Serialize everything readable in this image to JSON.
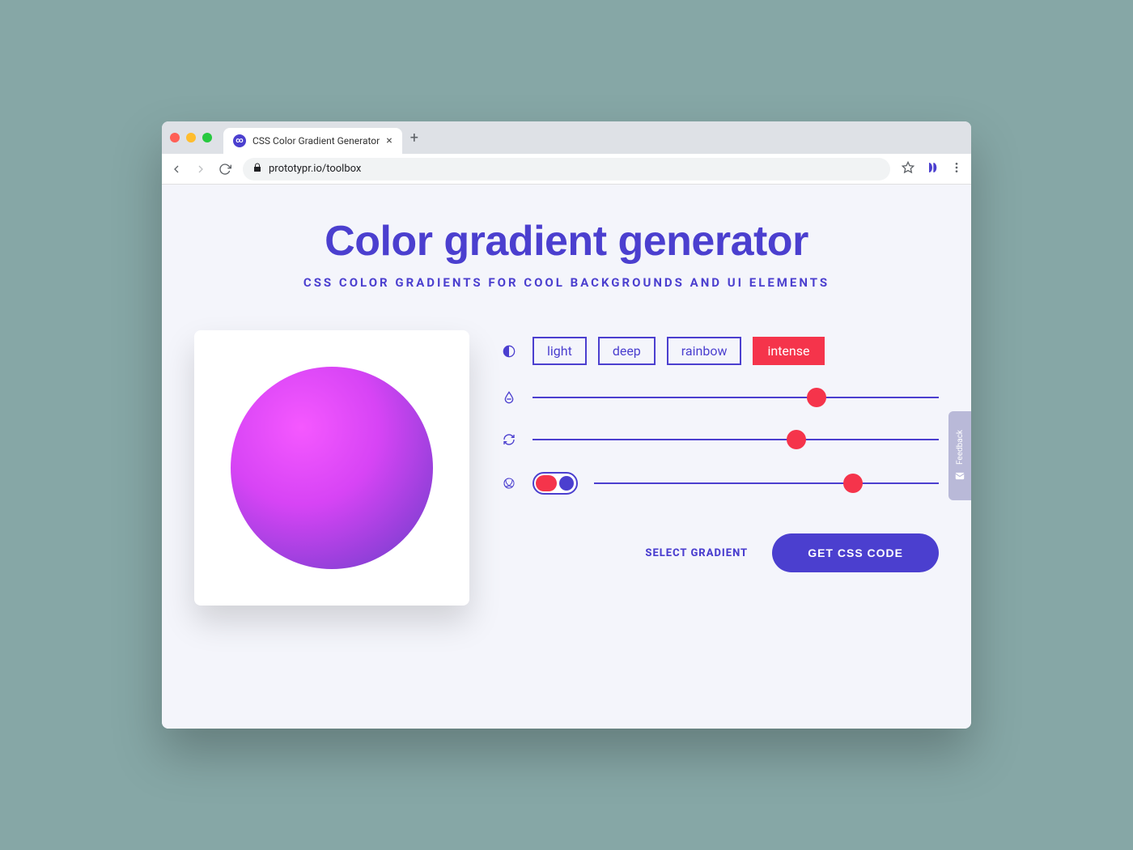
{
  "browser": {
    "tab_title": "CSS Color Gradient Generator",
    "url": "prototypr.io/toolbox"
  },
  "header": {
    "title": "Color gradient generator",
    "subtitle": "CSS COLOR GRADIENTS FOR COOL BACKGROUNDS AND UI ELEMENTS"
  },
  "presets": {
    "options": [
      "light",
      "deep",
      "rainbow",
      "intense"
    ],
    "active": "intense"
  },
  "sliders": {
    "hue_pct": 70,
    "rotate_pct": 65,
    "noise_pct": 75
  },
  "actions": {
    "select_label": "SELECT GRADIENT",
    "cta_label": "GET CSS CODE"
  },
  "feedback_label": "Feedback",
  "colors": {
    "primary": "#4b3fcf",
    "accent": "#f5344b"
  }
}
